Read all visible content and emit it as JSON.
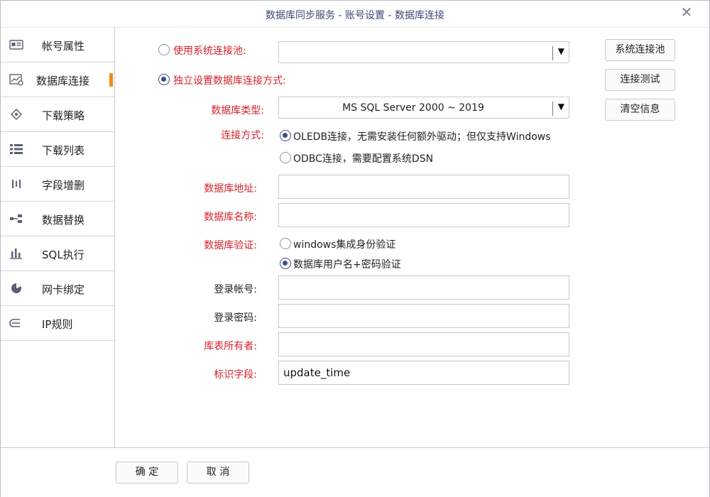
{
  "window": {
    "title": "数据库同步服务 - 账号设置 - 数据库连接",
    "close_icon": "close-icon"
  },
  "sidebar": {
    "items": [
      {
        "label": "帐号属性",
        "icon": "id-card-icon"
      },
      {
        "label": "数据库连接",
        "icon": "db-chart-icon",
        "active": true
      },
      {
        "label": "下载策略",
        "icon": "diamond-target-icon"
      },
      {
        "label": "下载列表",
        "icon": "list-icon"
      },
      {
        "label": "字段增删",
        "icon": "columns-icon"
      },
      {
        "label": "数据替换",
        "icon": "replace-icon"
      },
      {
        "label": "SQL执行",
        "icon": "bar-chart-icon"
      },
      {
        "label": "网卡绑定",
        "icon": "pie-icon"
      },
      {
        "label": "IP规则",
        "icon": "ip-rule-icon"
      }
    ],
    "active_color": "#f08a1a"
  },
  "form": {
    "use_pool_label": "使用系统连接池:",
    "pool_value": "",
    "independent_label": "独立设置数据库连接方式:",
    "dbtype_label": "数据库类型:",
    "dbtype_value": "MS SQL Server 2000 ~ 2019",
    "conn_mode_label": "连接方式:",
    "oledb_label": "OLEDB连接，无需安装任何额外驱动；但仅支持Windows",
    "odbc_label": "ODBC连接，需要配置系统DSN",
    "address_label": "数据库地址:",
    "address_value": "",
    "dbname_label": "数据库名称:",
    "dbname_value": "",
    "auth_label": "数据库验证:",
    "auth_windows_label": "windows集成身份验证",
    "auth_sql_label": "数据库用户名+密码验证",
    "login_label": "登录帐号:",
    "login_value": "",
    "password_label": "登录密码:",
    "password_value": "",
    "owner_label": "库表所有者:",
    "owner_value": "",
    "flag_label": "标识字段:",
    "flag_value": "update_time"
  },
  "side_buttons": {
    "pool": "系统连接池",
    "test": "连接测试",
    "clear": "清空信息"
  },
  "footer": {
    "ok": "确 定",
    "cancel": "取 消"
  },
  "colors": {
    "required_label": "#d6202a",
    "radio_checked": "#3e4c86",
    "title_text": "#3c4a78"
  }
}
